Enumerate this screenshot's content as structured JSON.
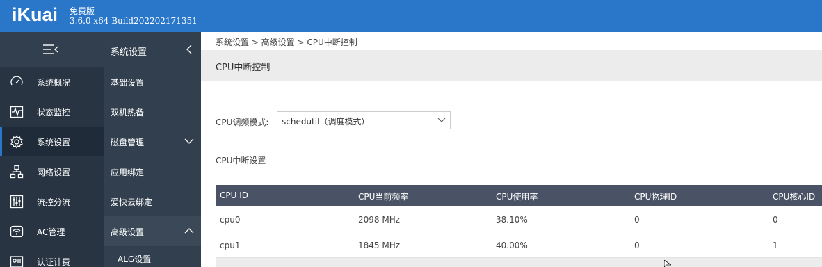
{
  "header": {
    "logo": "iKuai",
    "edition": "免费版",
    "version": "3.6.0 x64 Build202202171351"
  },
  "nav": {
    "items": [
      {
        "label": "系统概况",
        "icon": "dashboard-icon"
      },
      {
        "label": "状态监控",
        "icon": "monitor-icon"
      },
      {
        "label": "系统设置",
        "icon": "gear-icon",
        "active": true
      },
      {
        "label": "网络设置",
        "icon": "network-icon"
      },
      {
        "label": "流控分流",
        "icon": "sliders-icon"
      },
      {
        "label": "AC管理",
        "icon": "wifi-icon"
      },
      {
        "label": "认证计费",
        "icon": "auth-icon"
      }
    ]
  },
  "subnav": {
    "title": "系统设置",
    "items": [
      {
        "label": "基础设置"
      },
      {
        "label": "双机热备"
      },
      {
        "label": "磁盘管理"
      },
      {
        "label": "应用绑定"
      },
      {
        "label": "爱快云绑定"
      },
      {
        "label": "高级设置"
      },
      {
        "label": "ALG设置"
      }
    ]
  },
  "breadcrumb": "系统设置 > 高级设置 > CPU中断控制",
  "page_title": "CPU中断控制",
  "cpu_mode": {
    "label": "CPU调频模式:",
    "value": "schedutil（调度模式）"
  },
  "section_title": "CPU中断设置",
  "table": {
    "headers": [
      "CPU ID",
      "CPU当前频率",
      "CPU使用率",
      "CPU物理ID",
      "CPU核心ID"
    ],
    "rows": [
      [
        "cpu0",
        "2098 MHz",
        "38.10%",
        "0",
        "0"
      ],
      [
        "cpu1",
        "1845 MHz",
        "40.00%",
        "0",
        "1"
      ]
    ]
  },
  "colors": {
    "header": "#2a77c9",
    "nav_bg": "#283442",
    "subnav_bg": "#323f4e",
    "table_header": "#4a5366"
  }
}
